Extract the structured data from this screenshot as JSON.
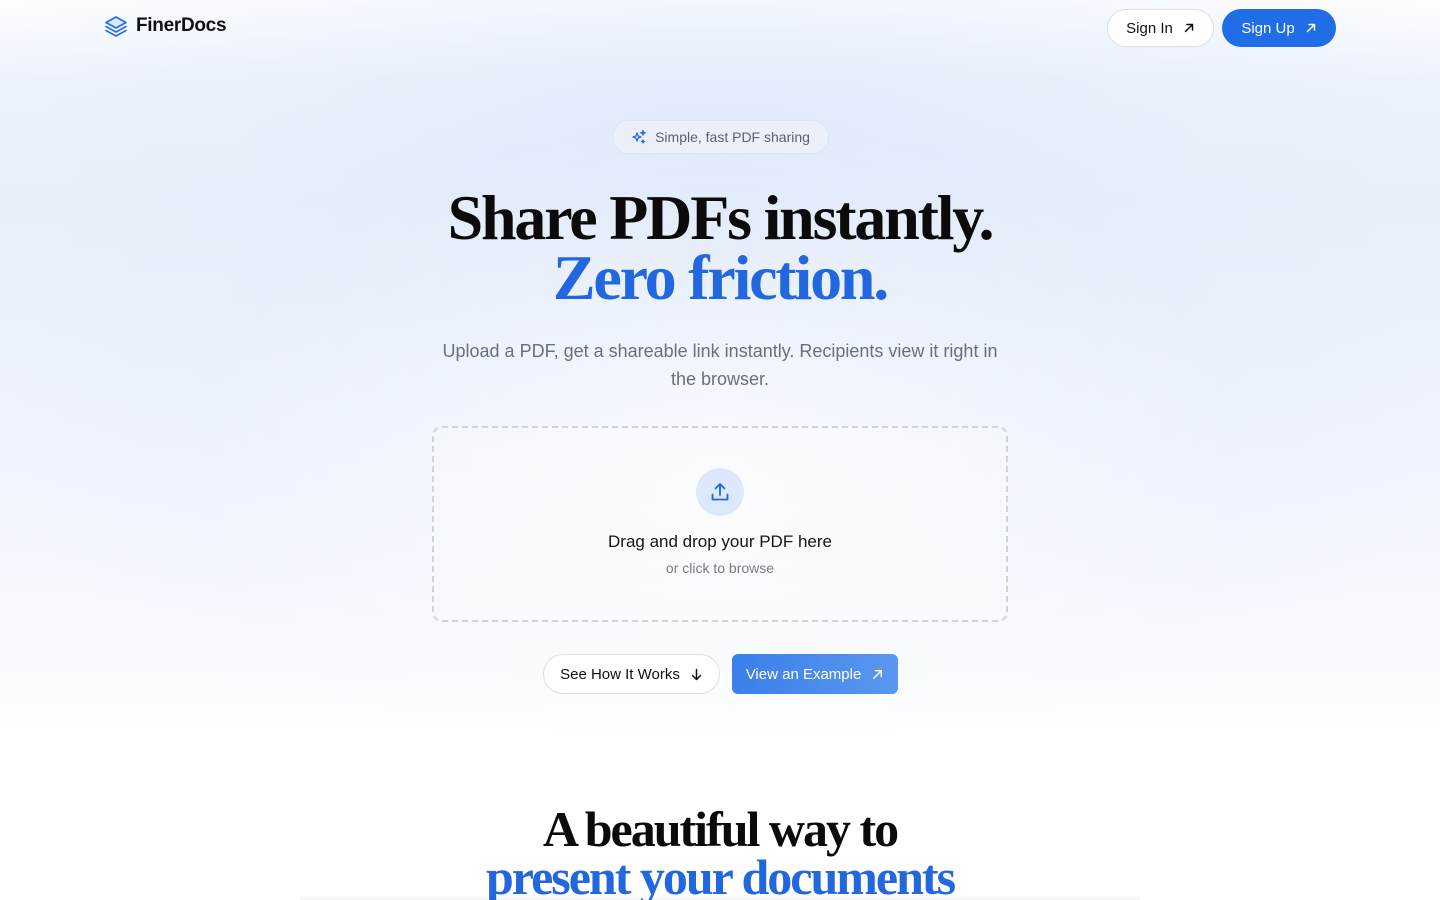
{
  "brand": {
    "name": "FinerDocs",
    "icon": "stack-layers-icon",
    "accent": "#1f6ee6"
  },
  "nav": {
    "sign_in": "Sign In",
    "sign_up": "Sign Up"
  },
  "hero": {
    "badge": "Simple, fast PDF sharing",
    "badge_icon": "sparkles-icon",
    "title_line1": "Share PDFs instantly.",
    "title_line2": "Zero friction.",
    "subtitle": "Upload a PDF, get a shareable link instantly. Recipients view it right in the browser."
  },
  "dropzone": {
    "icon": "upload-icon",
    "title": "Drag and drop your PDF here",
    "subtitle": "or click to browse"
  },
  "cta": {
    "how_it_works": "See How It Works",
    "view_example": "View an Example"
  },
  "section": {
    "title_line1": "A beautiful way to",
    "title_line2": "present your documents"
  }
}
